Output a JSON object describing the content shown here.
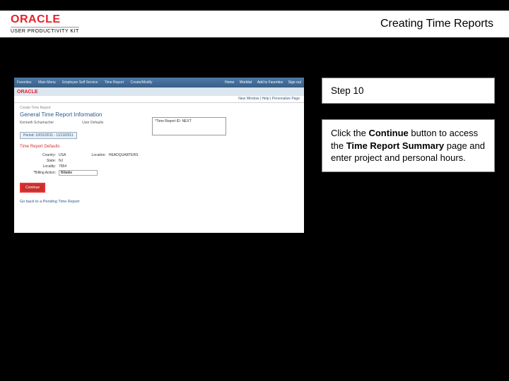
{
  "header": {
    "brand_main": "ORACLE",
    "brand_sub": "USER PRODUCTIVITY KIT",
    "title": "Creating Time Reports"
  },
  "instruction": {
    "step_label": "Step 10",
    "line1_a": "Click the ",
    "line1_b": "Continue",
    "line1_c": " button to access the ",
    "line2_bold": "Time Report Summary",
    "line2_rest": " page and enter project and personal hours."
  },
  "shot": {
    "topbar_tabs": [
      "Favorites",
      "Main Menu",
      "Employee Self Service",
      "Time Report",
      "Create/Modify"
    ],
    "topbar_links": [
      "Home",
      "Worklist",
      "Add to Favorites",
      "Sign out"
    ],
    "brand": "ORACLE",
    "navline": "New Window | Help | Personalize Page",
    "crumb": "Create Time Report",
    "h1": "General Time Report Information",
    "row_name_lbl": "Kenneth Schumacher",
    "row_user_lbl": "User Defaults",
    "req_field_lbl": "*Time Report ID:",
    "req_field_val": "NEXT",
    "pill": "Period: 10/31/2011 - 11/13/2011",
    "sect": "Time Report Defaults",
    "f_country_lbl": "Country:",
    "f_country_val": "USA",
    "f_state_lbl": "State:",
    "f_state_val": "NJ",
    "f_locality_lbl": "Locality:",
    "f_locality_val": "7954",
    "f_bill_lbl": "*Billing Action:",
    "f_bill_val": "Billable",
    "f_loc_lbl": "Location:",
    "f_loc_val": "HEADQUARTERS",
    "continue": "Continue",
    "footer": "Go back to a Pending Time Report"
  }
}
